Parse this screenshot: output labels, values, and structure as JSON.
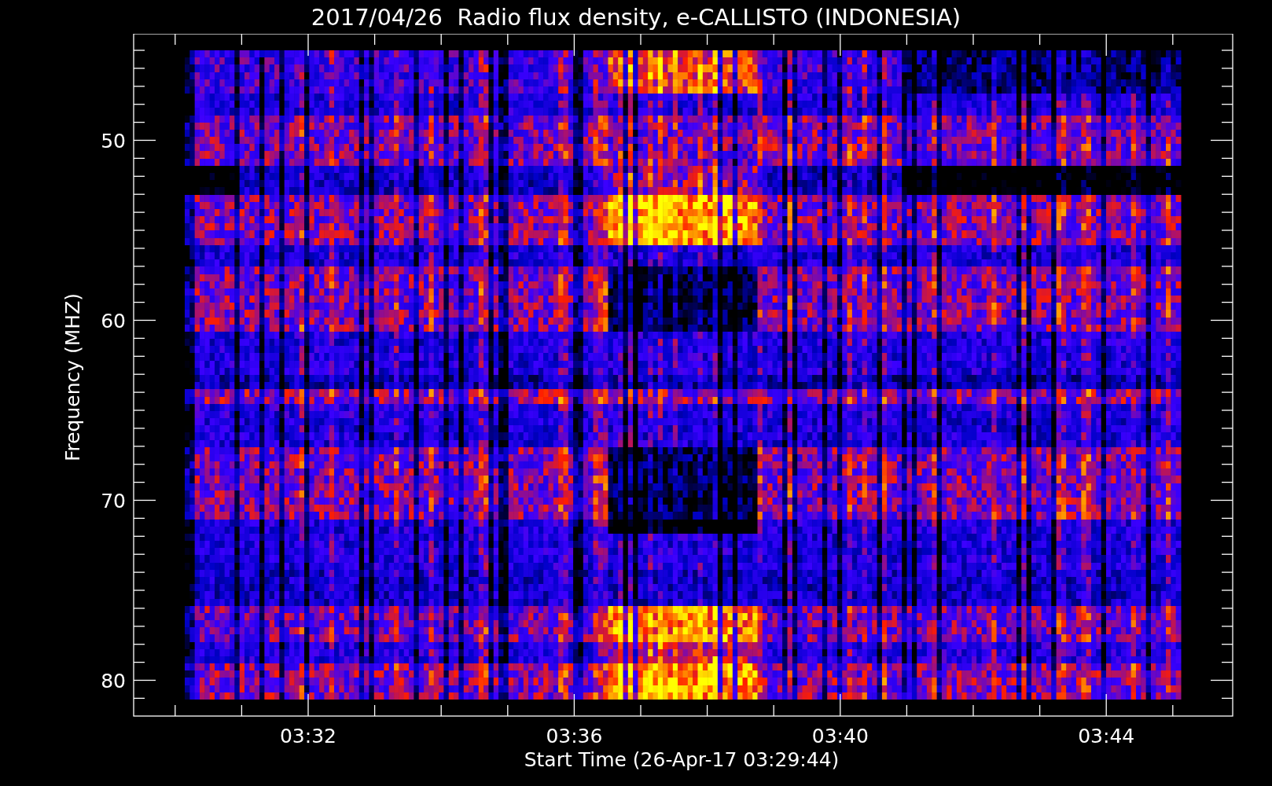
{
  "title": "2017/04/26  Radio flux density, e-CALLISTO (INDONESIA)",
  "y_axis": {
    "label": "Frequency (MHZ)",
    "ticks": [
      "50",
      "60",
      "70",
      "80"
    ]
  },
  "x_axis": {
    "label": "Start Time (26-Apr-17 03:29:44)",
    "ticks": [
      "03:32",
      "03:36",
      "03:40",
      "03:44"
    ]
  }
}
